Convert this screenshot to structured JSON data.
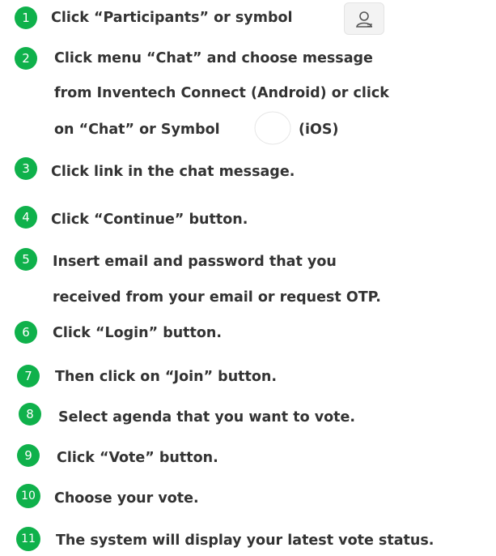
{
  "steps": [
    {
      "num": "1",
      "lines": [
        "Click “Participants” or symbol"
      ]
    },
    {
      "num": "2",
      "lines": [
        "Click menu “Chat” and choose message",
        "from Inventech Connect (Android) or click",
        "on “Chat” or Symbol",
        "(iOS)"
      ]
    },
    {
      "num": "3",
      "lines": [
        "Click link in the chat message."
      ]
    },
    {
      "num": "4",
      "lines": [
        "Click “Continue” button."
      ]
    },
    {
      "num": "5",
      "lines": [
        "Insert email and password that you",
        "received from your email or request OTP."
      ]
    },
    {
      "num": "6",
      "lines": [
        "Click “Login” button."
      ]
    },
    {
      "num": "7",
      "lines": [
        "Then click on “Join” button."
      ]
    },
    {
      "num": "8",
      "lines": [
        "Select agenda that you want to vote."
      ]
    },
    {
      "num": "9",
      "lines": [
        "Click “Vote” button."
      ]
    },
    {
      "num": "10",
      "lines": [
        "Choose your vote."
      ]
    },
    {
      "num": "11",
      "lines": [
        "The system will display your latest vote status."
      ]
    }
  ],
  "icons": {
    "participants": "participants-icon",
    "chat": "chat-bubble-icon"
  },
  "colors": {
    "badge": "#0fb14b",
    "text": "#333333"
  }
}
